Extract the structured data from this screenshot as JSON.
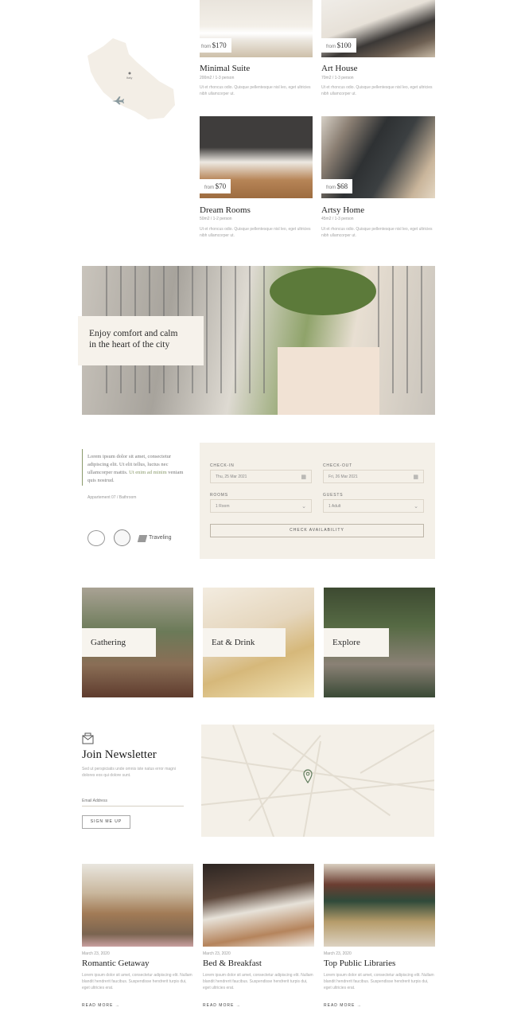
{
  "rooms": [
    {
      "name": "Minimal Suite",
      "meta": "200m2 / 1-3 person",
      "price_prefix": "from",
      "price": "$170",
      "desc": "Ut et rhoncus odio. Quisque pellentesque nisl leo, eget ultricies nibh ullamcorper ut."
    },
    {
      "name": "Art House",
      "meta": "70m2 / 1-3 person",
      "price_prefix": "from",
      "price": "$100",
      "desc": "Ut et rhoncus odio. Quisque pellentesque nisl leo, eget ultricies nibh ullamcorper ut."
    },
    {
      "name": "Dream Rooms",
      "meta": "50m2 / 1-2 person",
      "price_prefix": "from",
      "price": "$70",
      "desc": "Ut et rhoncus odio. Quisque pellentesque nisl leo, eget ultricies nibh ullamcorper ut."
    },
    {
      "name": "Artsy Home",
      "meta": "45m2 / 1-3 person",
      "price_prefix": "from",
      "price": "$68",
      "desc": "Ut et rhoncus odio. Quisque pellentesque nisl leo, eget ultricies nibh ullamcorper ut."
    }
  ],
  "map_marker_label": "Italy",
  "hero": {
    "line1": "Enjoy comfort and calm",
    "line2": "in the heart of the city"
  },
  "about": {
    "text_before": "Lorem ipsum dolor sit amet, consectetur adipiscing elit. Ut elit tellus, luctus nec ullamcorper mattis. ",
    "text_link": "Ut enim ad minim",
    "text_after": " veniam quis nostrud.",
    "address": "Appartement 07 / Bathroom",
    "badge_travel": "Traveling"
  },
  "booking": {
    "checkin_label": "CHECK-IN",
    "checkin_value": "Thu, 25 Mar 2021",
    "checkout_label": "CHECK-OUT",
    "checkout_value": "Fri, 26 Mar 2021",
    "rooms_label": "ROOMS",
    "rooms_value": "1 Room",
    "guests_label": "GUESTS",
    "guests_value": "1 Adult",
    "button": "CHECK AVAILABILITY"
  },
  "categories": [
    {
      "label": "Gathering"
    },
    {
      "label": "Eat & Drink"
    },
    {
      "label": "Explore"
    }
  ],
  "newsletter": {
    "title": "Join Newsletter",
    "text": "Sed ut perspiciatis unde omnis iste natus error magni dolores eos qui dolore sunt.",
    "placeholder": "Email Address",
    "button": "SIGN ME UP"
  },
  "blog": [
    {
      "date": "March 23, 2020",
      "title": "Romantic Getaway",
      "text": "Lorem ipsum dolor sit amet, consectetur adipiscing elit. Nullam blandit hendrerit faucibus. Suspendisse hendrerit turpis dui, eget ultricies erat.",
      "more": "READ MORE"
    },
    {
      "date": "March 23, 2020",
      "title": "Bed & Breakfast",
      "text": "Lorem ipsum dolor sit amet, consectetur adipiscing elit. Nullam blandit hendrerit faucibus. Suspendisse hendrerit turpis dui, eget ultricies erat.",
      "more": "READ MORE"
    },
    {
      "date": "March 23, 2020",
      "title": "Top Public Libraries",
      "text": "Lorem ipsum dolor sit amet, consectetur adipiscing elit. Nullam blandit hendrerit faucibus. Suspendisse hendrerit turpis dui, eget ultricies erat.",
      "more": "READ MORE"
    }
  ]
}
